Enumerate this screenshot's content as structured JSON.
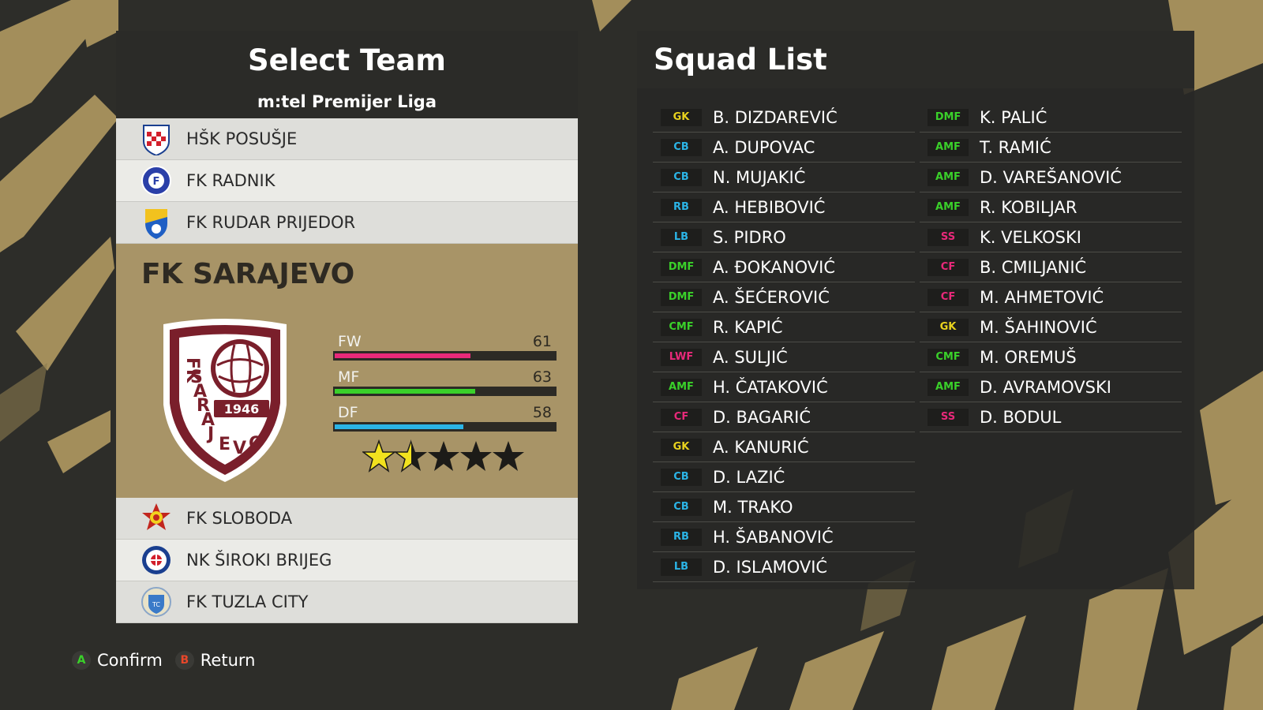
{
  "select_team": {
    "title": "Select Team",
    "league": "m:tel Premijer Liga",
    "teams_before": [
      {
        "name": "HŠK POSUŠJE",
        "crest": "posusje-crest-icon"
      },
      {
        "name": "FK RADNIK",
        "crest": "radnik-crest-icon"
      },
      {
        "name": "FK RUDAR PRIJEDOR",
        "crest": "rudar-crest-icon"
      }
    ],
    "selected": {
      "name": "FK SARAJEVO",
      "crest_text": "FK SARAJEVO",
      "crest_year": "1946",
      "stats": [
        {
          "label": "FW",
          "value": 61,
          "color": "#e8297a"
        },
        {
          "label": "MF",
          "value": 63,
          "color": "#3ad02a"
        },
        {
          "label": "DF",
          "value": 58,
          "color": "#2bb4e6"
        }
      ],
      "rating_stars": 1.5,
      "max_stars": 5
    },
    "teams_after": [
      {
        "name": "FK SLOBODA",
        "crest": "sloboda-crest-icon"
      },
      {
        "name": "NK ŠIROKI BRIJEG",
        "crest": "siroki-brijeg-crest-icon"
      },
      {
        "name": "FK TUZLA CITY",
        "crest": "tuzla-city-crest-icon"
      }
    ]
  },
  "squad": {
    "title": "Squad List",
    "left_column": [
      {
        "pos": "GK",
        "name": "B. DIZDAREVIĆ"
      },
      {
        "pos": "CB",
        "name": "A. DUPOVAC"
      },
      {
        "pos": "CB",
        "name": "N. MUJAKIĆ"
      },
      {
        "pos": "RB",
        "name": "A. HEBIBOVIĆ"
      },
      {
        "pos": "LB",
        "name": "S. PIDRO"
      },
      {
        "pos": "DMF",
        "name": "A. ĐOKANOVIĆ"
      },
      {
        "pos": "DMF",
        "name": "A. ŠEĆEROVIĆ"
      },
      {
        "pos": "CMF",
        "name": "R. KAPIĆ"
      },
      {
        "pos": "LWF",
        "name": "A. SULJIĆ"
      },
      {
        "pos": "AMF",
        "name": "H. ČATAKOVIĆ"
      },
      {
        "pos": "CF",
        "name": "D. BAGARIĆ"
      },
      {
        "pos": "GK",
        "name": "A. KANURIĆ"
      },
      {
        "pos": "CB",
        "name": "D. LAZIĆ"
      },
      {
        "pos": "CB",
        "name": "M. TRAKO"
      },
      {
        "pos": "RB",
        "name": "H. ŠABANOVIĆ"
      },
      {
        "pos": "LB",
        "name": "D. ISLAMOVIĆ"
      }
    ],
    "right_column": [
      {
        "pos": "DMF",
        "name": "K. PALIĆ"
      },
      {
        "pos": "AMF",
        "name": "T. RAMIĆ"
      },
      {
        "pos": "AMF",
        "name": "D. VAREŠANOVIĆ"
      },
      {
        "pos": "AMF",
        "name": "R. KOBILJAR"
      },
      {
        "pos": "SS",
        "name": "K. VELKOSKI"
      },
      {
        "pos": "CF",
        "name": "B. CMILJANIĆ"
      },
      {
        "pos": "CF",
        "name": "M. AHMETOVIĆ"
      },
      {
        "pos": "GK",
        "name": "M. ŠAHINOVIĆ"
      },
      {
        "pos": "CMF",
        "name": "M. OREMUŠ"
      },
      {
        "pos": "AMF",
        "name": "D. AVRAMOVSKI"
      },
      {
        "pos": "SS",
        "name": "D. BODUL"
      }
    ]
  },
  "position_colors": {
    "GK": "#e8d21e",
    "CB": "#2bb4e6",
    "RB": "#2bb4e6",
    "LB": "#2bb4e6",
    "DMF": "#3ad02a",
    "CMF": "#3ad02a",
    "AMF": "#3ad02a",
    "LWF": "#e8297a",
    "CF": "#e8297a",
    "SS": "#e8297a"
  },
  "footer": {
    "confirm": {
      "key": "A",
      "label": "Confirm",
      "color": "#3ad02a"
    },
    "return": {
      "key": "B",
      "label": "Return",
      "color": "#e8472a"
    }
  },
  "colors": {
    "accent_gold": "#a89467",
    "panel_dark": "#2b2b28"
  }
}
